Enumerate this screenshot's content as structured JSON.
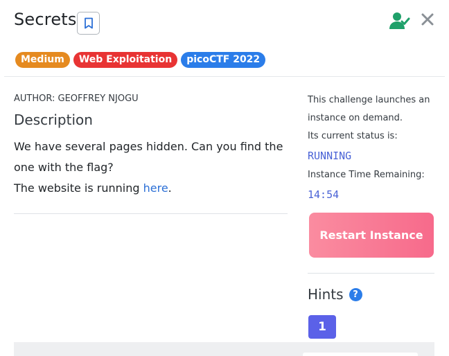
{
  "header": {
    "title": "Secrets",
    "tags": [
      {
        "label": "Medium",
        "color": "#e58a20"
      },
      {
        "label": "Web Exploitation",
        "color": "#e83434"
      },
      {
        "label": "picoCTF 2022",
        "color": "#2b7de9"
      }
    ],
    "icons": {
      "bookmark": "bookmark-icon",
      "user_check": "user-check-icon",
      "close": "close-icon"
    },
    "accent_green": "#1fa06a"
  },
  "main": {
    "author": "AUTHOR: GEOFFREY NJOGU",
    "description_title": "Description",
    "description": "We have several pages hidden. Can you find the one with the flag?",
    "running_prefix": "The website is running ",
    "link_text": "here",
    "running_suffix": "."
  },
  "sidebar": {
    "launch_text": "This challenge launches an instance on demand.",
    "status_label": "Its current status is:",
    "status_value": "RUNNING",
    "time_label": "Instance Time Remaining:",
    "time_value": "14:54",
    "restart_label": "Restart Instance",
    "hints_title": "Hints",
    "help_icon": "?",
    "hint_buttons": [
      "1"
    ]
  }
}
